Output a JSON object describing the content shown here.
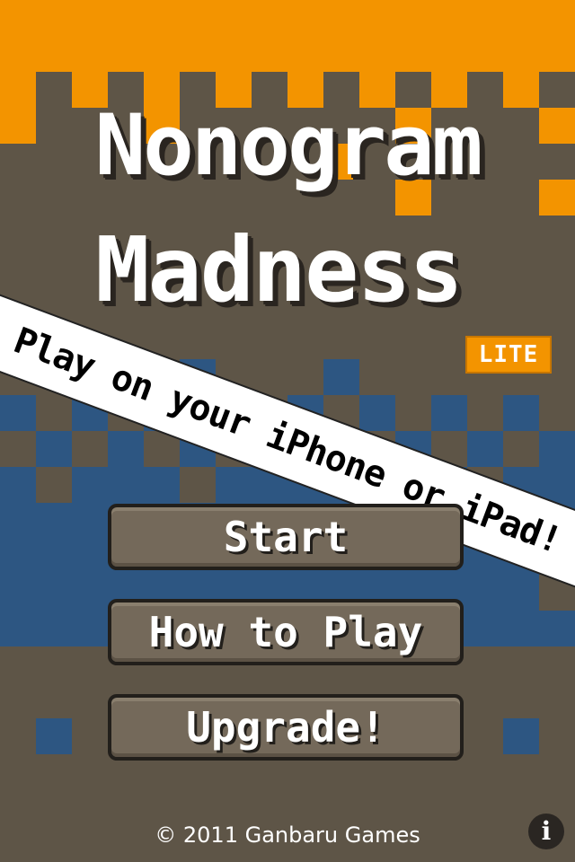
{
  "title": {
    "line1": "Nonogram",
    "line2": "Madness",
    "edition_badge": "LITE"
  },
  "banner": {
    "text": "Play on your iPhone or iPad!"
  },
  "menu": {
    "start_label": "Start",
    "how_to_play_label": "How to Play",
    "upgrade_label": "Upgrade!"
  },
  "footer": {
    "copyright": "© 2011 Ganbaru Games",
    "info_icon": "info-icon",
    "info_glyph": "i"
  },
  "colors": {
    "orange": "#f39400",
    "brown": "#5e5547",
    "blue": "#2d5682",
    "button": "#74695a",
    "dark": "#221f1b"
  }
}
